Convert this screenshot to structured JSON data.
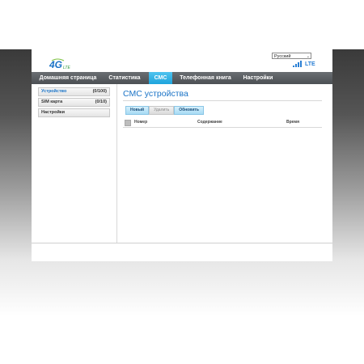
{
  "logo": {
    "text": "4G",
    "sub": "LTE"
  },
  "language": {
    "selected": "Русский"
  },
  "status": {
    "network": "LTE"
  },
  "nav": [
    {
      "label": "Домашняя страница"
    },
    {
      "label": "Статистика"
    },
    {
      "label": "СМС"
    },
    {
      "label": "Телефонная книга"
    },
    {
      "label": "Настройки"
    }
  ],
  "sidebar": [
    {
      "label": "Устройство",
      "count": "(0/100)"
    },
    {
      "label": "SIM карта",
      "count": "(0/10)"
    },
    {
      "label": "Настройки",
      "count": ""
    }
  ],
  "main": {
    "title": "СМС устройства",
    "buttons": {
      "new": "Новый",
      "delete": "Удалить",
      "refresh": "Обновить"
    },
    "columns": {
      "number": "Номер",
      "content": "Содержание",
      "time": "Время"
    }
  },
  "colors": {
    "accent": "#1a73c6",
    "active_tab": "#1ea4dc",
    "navbar": "#55595d"
  }
}
